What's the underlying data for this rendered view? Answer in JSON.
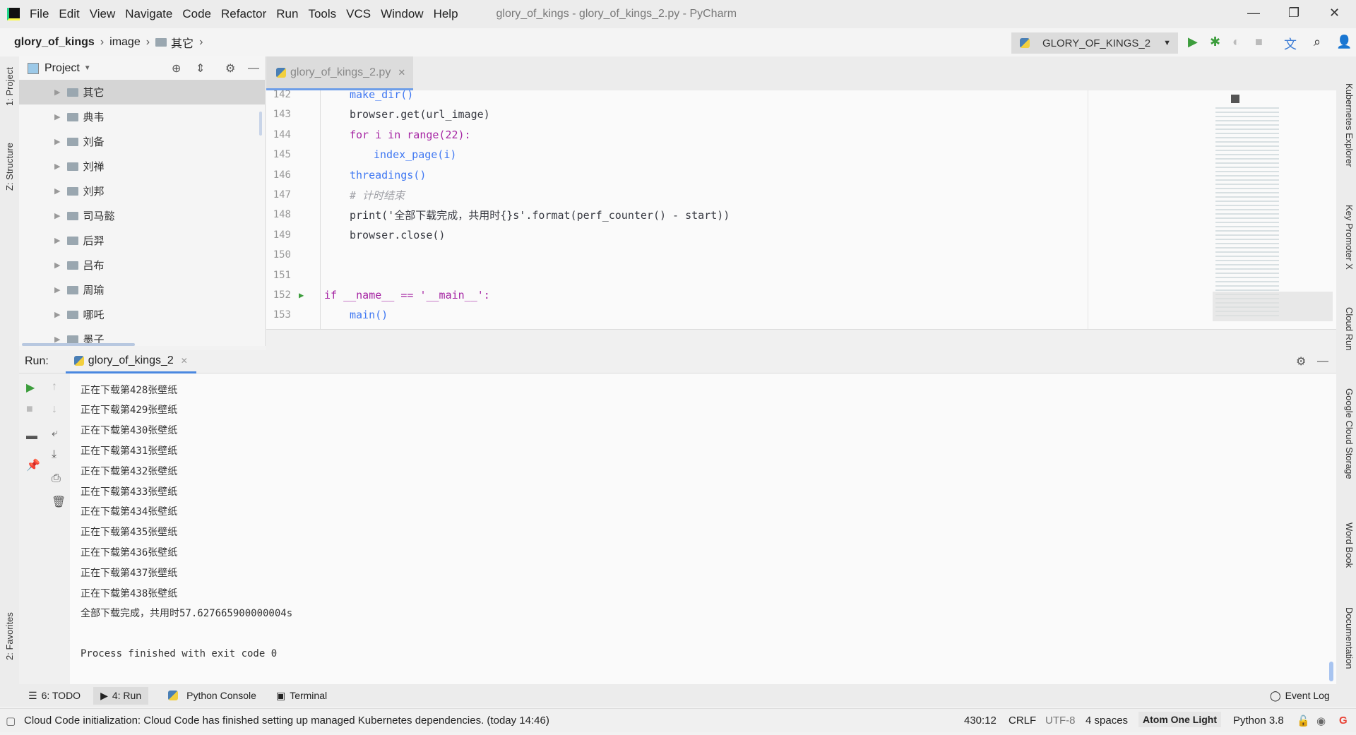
{
  "menubar": {
    "items": [
      "File",
      "Edit",
      "View",
      "Navigate",
      "Code",
      "Refactor",
      "Run",
      "Tools",
      "VCS",
      "Window",
      "Help"
    ],
    "title": "glory_of_kings - glory_of_kings_2.py - PyCharm"
  },
  "breadcrumb": {
    "items": [
      "glory_of_kings",
      "image",
      "其它"
    ]
  },
  "toolbar": {
    "run_config": "GLORY_OF_KINGS_2"
  },
  "left_strip": {
    "project": "1: Project",
    "structure": "Z: Structure",
    "favorites": "2: Favorites"
  },
  "right_strip": [
    "Kubernetes Explorer",
    "Key Promoter X",
    "Cloud Run",
    "Google Cloud Storage",
    "Word Book",
    "Documentation"
  ],
  "project": {
    "title": "Project",
    "items": [
      "其它",
      "典韦",
      "刘备",
      "刘禅",
      "刘邦",
      "司马懿",
      "后羿",
      "吕布",
      "周瑜",
      "哪吒",
      "墨子"
    ]
  },
  "editor": {
    "tab": "glory_of_kings_2.py",
    "lines": [
      {
        "n": "142",
        "code": "make_dir()"
      },
      {
        "n": "143",
        "code": "browser.get(url_image)"
      },
      {
        "n": "144",
        "code": "for i in range(22):"
      },
      {
        "n": "145",
        "code": "index_page(i)"
      },
      {
        "n": "146",
        "code": "threadings()"
      },
      {
        "n": "147",
        "code": "# 计时结束"
      },
      {
        "n": "148",
        "code": "print('全部下载完成，共用时{}s'.format(perf_counter() - start))"
      },
      {
        "n": "149",
        "code": "browser.close()"
      },
      {
        "n": "150",
        "code": ""
      },
      {
        "n": "151",
        "code": ""
      },
      {
        "n": "152",
        "code": "if __name__ == '__main__':"
      },
      {
        "n": "153",
        "code": "main()"
      }
    ]
  },
  "run": {
    "label": "Run:",
    "tab": "glory_of_kings_2",
    "output": [
      "正在下载第428张壁纸",
      "正在下载第429张壁纸",
      "正在下载第430张壁纸",
      "正在下载第431张壁纸",
      "正在下载第432张壁纸",
      "正在下载第433张壁纸",
      "正在下载第434张壁纸",
      "正在下载第435张壁纸",
      "正在下载第436张壁纸",
      "正在下载第437张壁纸",
      "正在下载第438张壁纸",
      "全部下载完成，共用时57.627665900000004s",
      "",
      "Process finished with exit code 0"
    ]
  },
  "bottom_tabs": [
    "6: TODO",
    "4: Run",
    "Python Console",
    "Terminal"
  ],
  "event_log": "Event Log",
  "status": {
    "message": "Cloud Code initialization: Cloud Code has finished setting up managed Kubernetes dependencies. (today 14:46)",
    "position": "430:12",
    "line_sep": "CRLF",
    "encoding": "UTF-8",
    "indent": "4 spaces",
    "theme": "Atom One Light",
    "interpreter": "Python 3.8"
  }
}
